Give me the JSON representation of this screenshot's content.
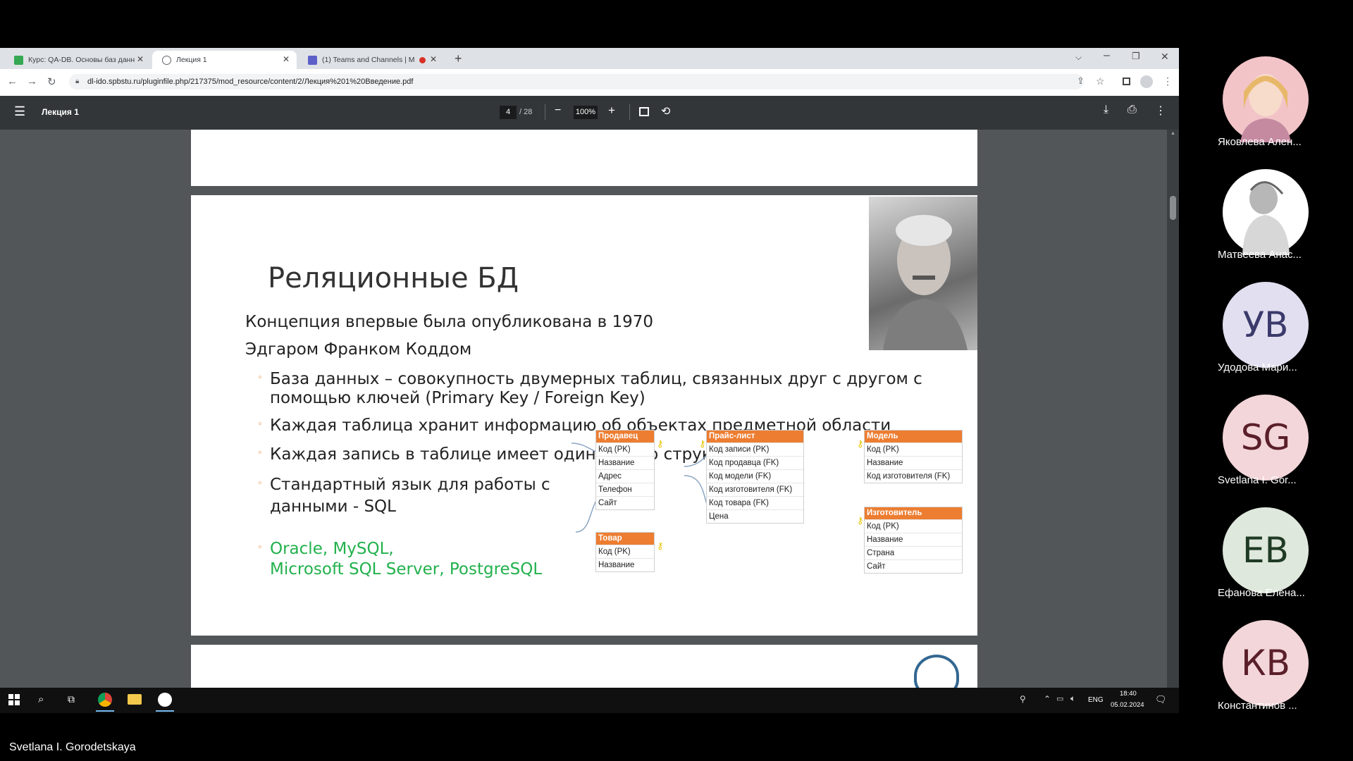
{
  "browser": {
    "tabs": [
      {
        "title": "Курс: QA-DB. Основы баз данн",
        "icon": "sheets-icon",
        "color": "#34a853"
      },
      {
        "title": "Лекция 1",
        "icon": "globe-icon"
      },
      {
        "title": "(1) Teams and Channels | M",
        "icon": "teams-icon",
        "color": "#5b5fc7"
      }
    ],
    "url": "dl-ido.spbstu.ru/pluginfile.php/217375/mod_resource/content/2/Лекция%201%20Введение.pdf"
  },
  "pdf_viewer": {
    "title": "Лекция 1",
    "current_page": "4",
    "total_pages": "/ 28",
    "zoom": "100%"
  },
  "slide": {
    "title": "Реляционные БД",
    "intro_line1": "Концепция впервые была опубликована в 1970",
    "intro_line2": "Эдгаром Франком Коддом",
    "bullets": [
      "База данных – совокупность  двумерных таблиц, связанных друг с другом с",
      "помощью ключей (Primary Key / Foreign Key)",
      "Каждая таблица хранит информацию об объектах предметной области",
      "Каждая запись в таблице имеет одинаковую структуру",
      "Стандартный язык для работы с",
      "данными - SQL"
    ],
    "green_line1": "Oracle, MySQL,",
    "green_line2": "Microsoft SQL Server, PostgreSQL",
    "tables": {
      "seller": {
        "header": "Продавец",
        "rows": [
          "Код (PK)",
          "Название",
          "Адрес",
          "Телефон",
          "Сайт"
        ]
      },
      "pricelist": {
        "header": "Прайс-лист",
        "rows": [
          "Код записи (PK)",
          "Код продавца (FK)",
          "Код модели (FK)",
          "Код изготовителя (FK)",
          "Код товара (FK)",
          "Цена"
        ]
      },
      "model": {
        "header": "Модель",
        "rows": [
          "Код (PK)",
          "Название",
          "Код изготовителя (FK)"
        ]
      },
      "product": {
        "header": "Товар",
        "rows": [
          "Код (PK)",
          "Название"
        ]
      },
      "manufacturer": {
        "header": "Изготовитель",
        "rows": [
          "Код (PK)",
          "Название",
          "Страна",
          "Сайт"
        ]
      }
    }
  },
  "taskbar": {
    "lang": "ENG",
    "time": "18:40",
    "date": "05.02.2024"
  },
  "participants": [
    {
      "name": "Яковлева Ален...",
      "initials": "",
      "bg": "#f2c4c8"
    },
    {
      "name": "Матвеева Анас...",
      "initials": "",
      "bg": "#ffffff"
    },
    {
      "name": "Удодова Мари...",
      "initials": "УВ",
      "bg": "#e2dff0",
      "fg": "#3b3a6b"
    },
    {
      "name": "Svetlana I. Gor...",
      "initials": "SG",
      "bg": "#f3d6d9",
      "fg": "#5a1f2a"
    },
    {
      "name": "Ефанова Елена...",
      "initials": "ЕВ",
      "bg": "#dfe8dc",
      "fg": "#1f3a25"
    },
    {
      "name": "Константинов ...",
      "initials": "КВ",
      "bg": "#f3d6d9",
      "fg": "#5a1f2a"
    }
  ],
  "speaker_name": "Svetlana I. Gorodetskaya"
}
